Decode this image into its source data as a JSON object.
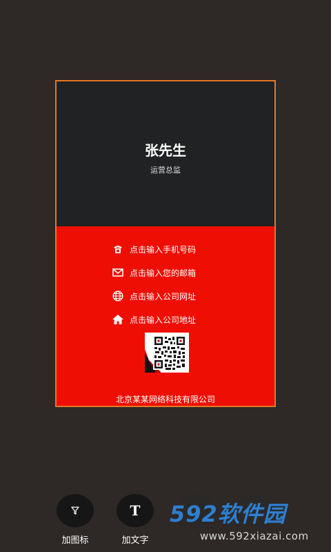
{
  "card": {
    "name": "张先生",
    "title": "运营总监",
    "phone": "点击输入手机号码",
    "email": "点击输入您的邮箱",
    "website": "点击输入公司网址",
    "address": "点击输入公司地址",
    "company": "北京某某网络科技有限公司"
  },
  "toolbar": {
    "add_icon_label": "加图标",
    "add_text_label": "加文字"
  },
  "watermark": {
    "brand": "592软件园",
    "url": "www.592xiazai.com"
  },
  "colors": {
    "background": "#2e2826",
    "card_top": "#202223",
    "card_bottom": "#ef0e03",
    "card_border": "#e37a26",
    "watermark_blue": "#2d7fd1"
  },
  "icons": [
    "phone-icon",
    "mail-icon",
    "globe-icon",
    "home-icon",
    "qr-code",
    "funnel-icon",
    "text-icon"
  ]
}
